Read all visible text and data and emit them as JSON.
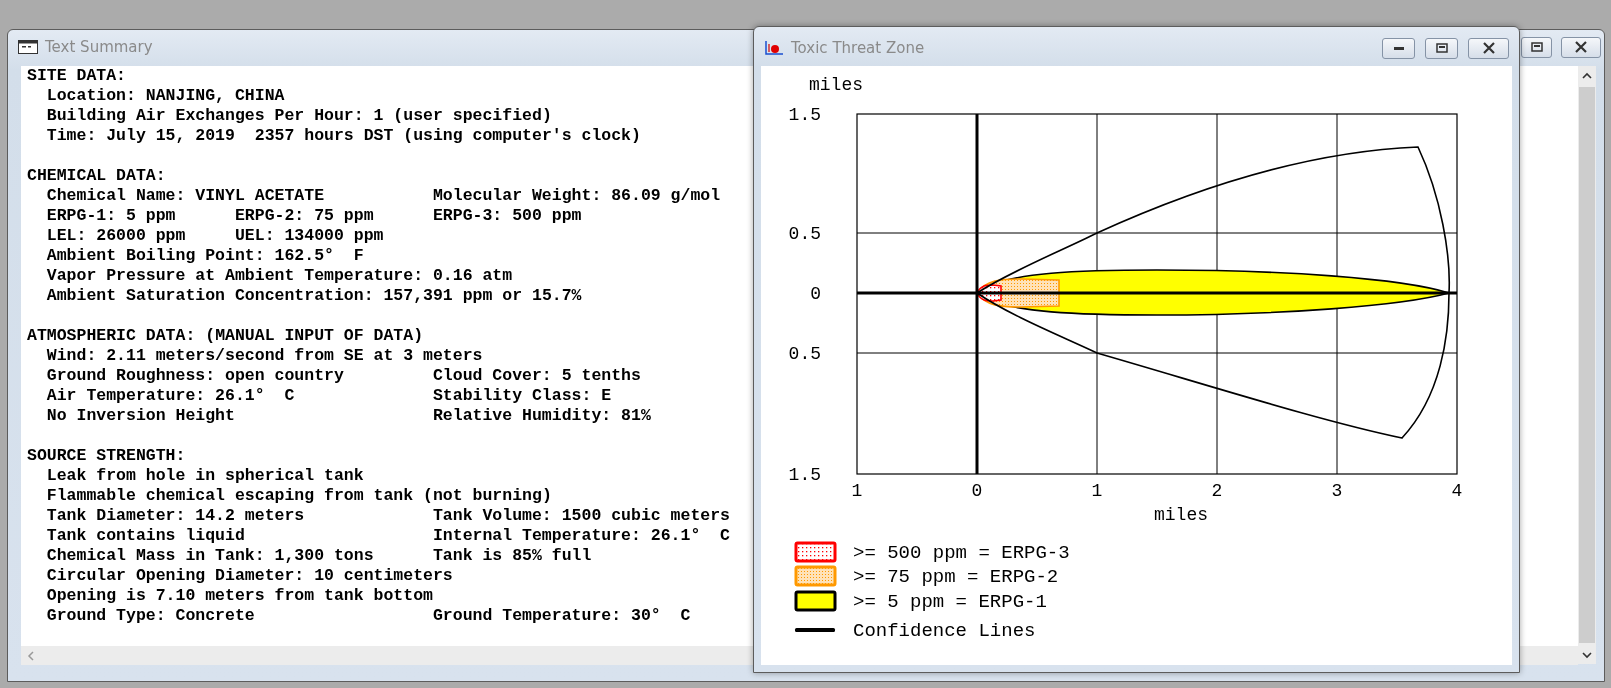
{
  "text_summary": {
    "title": "Text Summary",
    "sections": [
      {
        "heading": "SITE DATA:",
        "lines": [
          {
            "kind": "single",
            "cells": [
              "Location: NANJING, CHINA"
            ]
          },
          {
            "kind": "single",
            "cells": [
              "Building Air Exchanges Per Hour: 1 (user specified)"
            ]
          },
          {
            "kind": "single",
            "cells": [
              "Time: July 15, 2019  2357 hours DST (using computer's clock)"
            ]
          }
        ]
      },
      {
        "heading": "CHEMICAL DATA:",
        "lines": [
          {
            "kind": "pair",
            "cells": [
              "Chemical Name: VINYL ACETATE",
              "Molecular Weight: 86.09 g/mol"
            ]
          },
          {
            "kind": "triple",
            "cells": [
              "ERPG-1: 5 ppm",
              "ERPG-2: 75 ppm",
              "ERPG-3: 500 ppm"
            ]
          },
          {
            "kind": "split",
            "cells": [
              "LEL: 26000 ppm",
              "UEL: 134000 ppm"
            ]
          },
          {
            "kind": "single",
            "cells": [
              "Ambient Boiling Point: 162.5°  F"
            ]
          },
          {
            "kind": "single",
            "cells": [
              "Vapor Pressure at Ambient Temperature: 0.16 atm"
            ]
          },
          {
            "kind": "single",
            "cells": [
              "Ambient Saturation Concentration: 157,391 ppm or 15.7%"
            ]
          }
        ]
      },
      {
        "heading": "ATMOSPHERIC DATA: (MANUAL INPUT OF DATA)",
        "lines": [
          {
            "kind": "single",
            "cells": [
              "Wind: 2.11 meters/second from SE at 3 meters"
            ]
          },
          {
            "kind": "pair",
            "cells": [
              "Ground Roughness: open country",
              "Cloud Cover: 5 tenths"
            ]
          },
          {
            "kind": "pair",
            "cells": [
              "Air Temperature: 26.1°  C",
              "Stability Class: E"
            ]
          },
          {
            "kind": "pair",
            "cells": [
              "No Inversion Height",
              "Relative Humidity: 81%"
            ]
          }
        ]
      },
      {
        "heading": "SOURCE STRENGTH:",
        "lines": [
          {
            "kind": "single",
            "cells": [
              "Leak from hole in spherical tank"
            ]
          },
          {
            "kind": "single",
            "cells": [
              "Flammable chemical escaping from tank (not burning)"
            ]
          },
          {
            "kind": "pair",
            "cells": [
              "Tank Diameter: 14.2 meters",
              "Tank Volume: 1500 cubic meters"
            ]
          },
          {
            "kind": "pair",
            "cells": [
              "Tank contains liquid",
              "Internal Temperature: 26.1°  C"
            ]
          },
          {
            "kind": "pair",
            "cells": [
              "Chemical Mass in Tank: 1,300 tons",
              "Tank is 85% full"
            ]
          },
          {
            "kind": "single",
            "cells": [
              "Circular Opening Diameter: 10 centimeters"
            ]
          },
          {
            "kind": "single",
            "cells": [
              "Opening is 7.10 meters from tank bottom"
            ]
          },
          {
            "kind": "pair",
            "cells": [
              "Ground Type: Concrete",
              "Ground Temperature: 30°  C"
            ]
          }
        ]
      }
    ]
  },
  "threat_zone": {
    "title": "Toxic Threat Zone",
    "plot": {
      "ylabel": "miles",
      "xlabel": "miles",
      "yticks": [
        "1.5",
        "0.5",
        "0",
        "0.5",
        "1.5"
      ],
      "xticks": [
        "1",
        "0",
        "1",
        "2",
        "3",
        "4"
      ]
    },
    "legend": [
      {
        "kind": "dotted",
        "color": "#ff0000",
        "label": ">= 500 ppm = ERPG-3"
      },
      {
        "kind": "shaded",
        "color": "#ff9900",
        "label": ">= 75 ppm = ERPG-2"
      },
      {
        "kind": "solid",
        "color": "#ffff00",
        "label": ">= 5 ppm = ERPG-1"
      },
      {
        "kind": "line",
        "color": "#000000",
        "label": "Confidence Lines"
      }
    ]
  }
}
